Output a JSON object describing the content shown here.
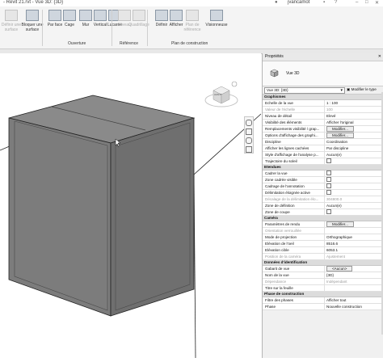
{
  "titlebar": {
    "title": "- Revit 21.rvt - Vue 3D: {3D}",
    "user": "jvancamot"
  },
  "ribbon": {
    "buttons": [
      {
        "label": "Définir une surface",
        "gray": true
      },
      {
        "label": "Bloquer une surface",
        "gray": false
      },
      {
        "label": "Par face",
        "gray": false
      },
      {
        "label": "Cage",
        "gray": false
      },
      {
        "label": "Mur",
        "gray": false
      },
      {
        "label": "Vertical",
        "gray": false
      },
      {
        "label": "Lucarne",
        "gray": false
      },
      {
        "label": "Niveau",
        "gray": true
      },
      {
        "label": "Quadrillage",
        "gray": true
      },
      {
        "label": "Définir",
        "gray": false
      },
      {
        "label": "Afficher",
        "gray": false
      },
      {
        "label": "Plan de référence",
        "gray": true
      },
      {
        "label": "Visionneuse",
        "gray": false
      }
    ],
    "groups": [
      "Ouverture",
      "Référence",
      "Plan de construction"
    ]
  },
  "properties": {
    "title": "Propriétés",
    "close": "✕",
    "type_name": "Vue 3D",
    "selector": "Vue 3D: {3D}",
    "edit_type": "Modifier le type",
    "sections": [
      {
        "title": "Graphismes",
        "rows": [
          {
            "k": "Echelle de la vue",
            "v": "1 : 100",
            "t": "text"
          },
          {
            "k": "Valeur de l'échelle",
            "v": "100",
            "t": "text",
            "dis": true
          },
          {
            "k": "Niveau de détail",
            "v": "Elevé",
            "t": "text"
          },
          {
            "k": "Visibilité des éléments",
            "v": "Afficher l'original",
            "t": "text"
          },
          {
            "k": "Remplacements visibilité / grap...",
            "v": "Modifier...",
            "t": "btn"
          },
          {
            "k": "Options d'affichage des graphi...",
            "v": "Modifier...",
            "t": "btn"
          },
          {
            "k": "Discipline",
            "v": "Coordination",
            "t": "text"
          },
          {
            "k": "Afficher les lignes cachées",
            "v": "Par discipline",
            "t": "text"
          },
          {
            "k": "Style d'affichage de l'analyse p...",
            "v": "Aucun(e)",
            "t": "text"
          },
          {
            "k": "Trajectoire du soleil",
            "v": "",
            "t": "cb"
          }
        ]
      },
      {
        "title": "Etendues",
        "rows": [
          {
            "k": "Cadrer la vue",
            "v": "",
            "t": "cb"
          },
          {
            "k": "Zone cadrée visible",
            "v": "",
            "t": "cb"
          },
          {
            "k": "Cadrage de l'annotation",
            "v": "",
            "t": "cb"
          },
          {
            "k": "Délimitation éloignée active",
            "v": "",
            "t": "cb"
          },
          {
            "k": "Décalage de la délimitation élo...",
            "v": "304800.0",
            "t": "text",
            "dis": true
          },
          {
            "k": "Zone de définition",
            "v": "Aucun(e)",
            "t": "text"
          },
          {
            "k": "Zone de coupe",
            "v": "",
            "t": "cb"
          }
        ]
      },
      {
        "title": "Caméra",
        "rows": [
          {
            "k": "Paramètres de rendu",
            "v": "Modifier...",
            "t": "btn"
          },
          {
            "k": "Orientation verrouillée",
            "v": "",
            "t": "text",
            "dis": true
          },
          {
            "k": "Mode de projection",
            "v": "Orthographique",
            "t": "text"
          },
          {
            "k": "Elévation de l'oeil",
            "v": "8516.6",
            "t": "text"
          },
          {
            "k": "Elévation cible",
            "v": "6053.1",
            "t": "text"
          },
          {
            "k": "Position de la caméra",
            "v": "Ajustement",
            "t": "text",
            "dis": true
          }
        ]
      },
      {
        "title": "Données d'identification",
        "rows": [
          {
            "k": "Gabarit de vue",
            "v": "<Aucun>",
            "t": "btn"
          },
          {
            "k": "Nom de la vue",
            "v": "{3D}",
            "t": "text"
          },
          {
            "k": "Dépendance",
            "v": "Indépendant",
            "t": "text",
            "dis": true
          },
          {
            "k": "Titre sur la feuille",
            "v": "",
            "t": "text"
          }
        ]
      },
      {
        "title": "Phase de construction",
        "rows": [
          {
            "k": "Filtre des phases",
            "v": "Afficher tout",
            "t": "text"
          },
          {
            "k": "Phase",
            "v": "Nouvelle construction",
            "t": "text"
          }
        ]
      }
    ]
  },
  "viewcube": {
    "face_label": "AVANT"
  }
}
